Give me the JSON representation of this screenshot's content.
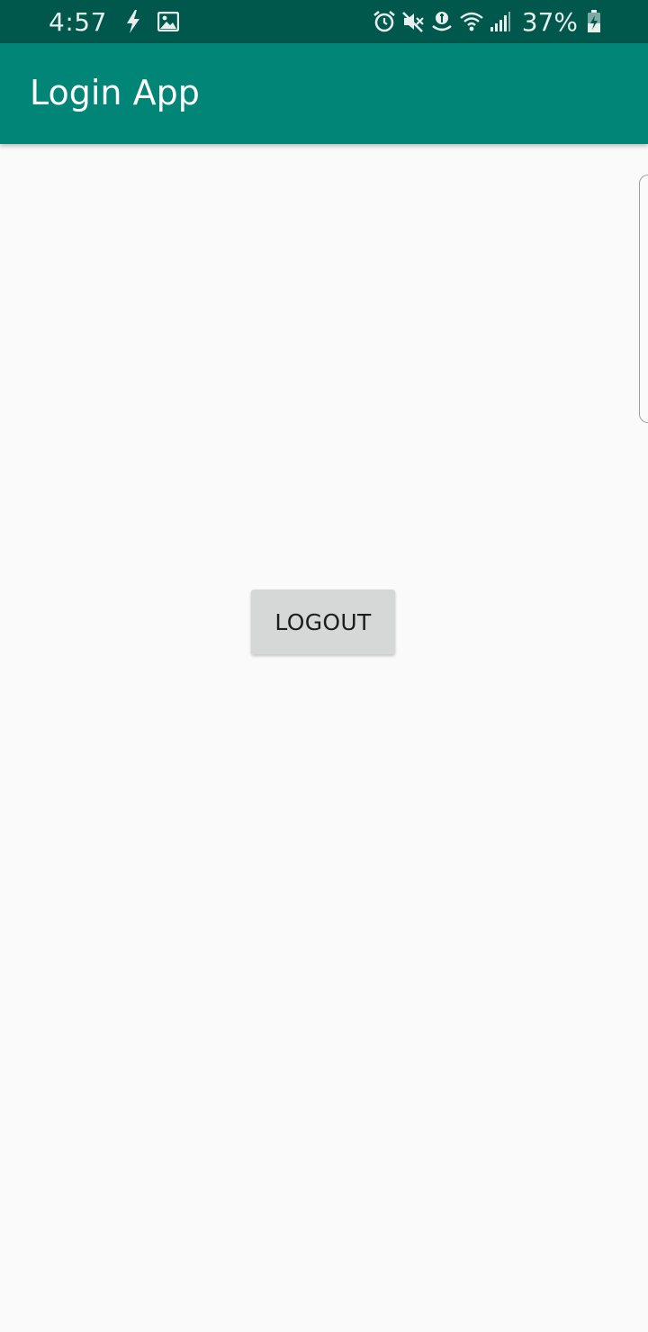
{
  "status_bar": {
    "time": "4:57",
    "battery_percent": "37%",
    "left_icons": [
      "flash-icon",
      "image-icon"
    ],
    "right_icons": [
      "alarm-icon",
      "mute-icon",
      "location-icon",
      "wifi-icon",
      "signal-icon",
      "battery-charging-icon"
    ]
  },
  "app_bar": {
    "title": "Login App",
    "color": "#008577"
  },
  "main": {
    "logout_label": "LOGOUT"
  },
  "colors": {
    "status_bar": "#00574b",
    "background": "#fafafa",
    "button": "#d6d7d7"
  }
}
